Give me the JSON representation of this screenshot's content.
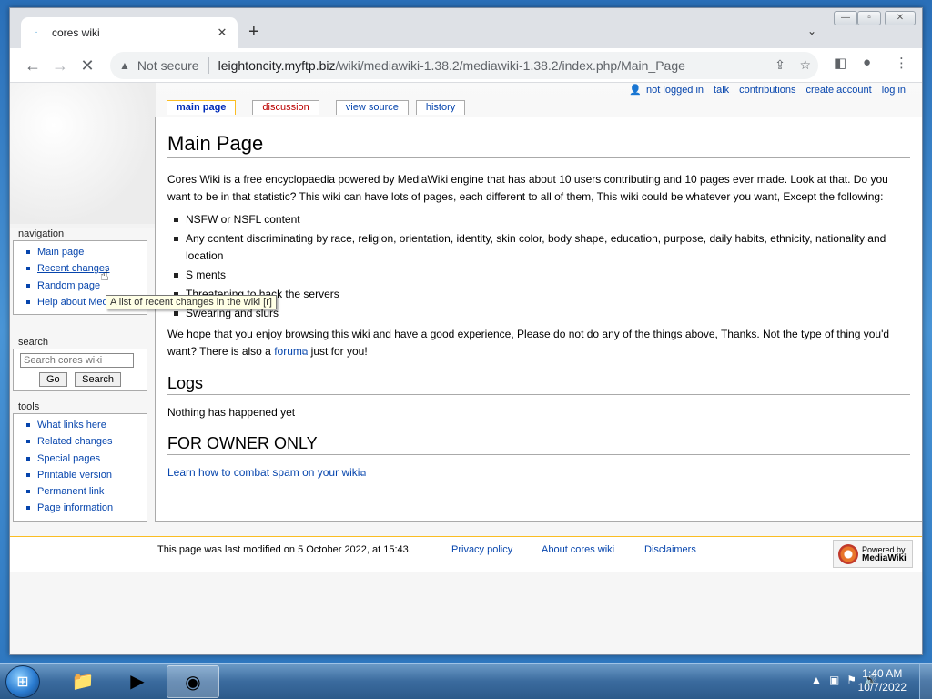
{
  "browser": {
    "tab_title": "cores wiki",
    "tab_favicon": "·",
    "tab_close": "✕",
    "new_tab": "+",
    "tab_search": "⌄",
    "security_label": "Not secure",
    "url_host": "leightoncity.myftp.biz",
    "url_path": "/wiki/mediawiki-1.38.2/mediawiki-1.38.2/index.php/Main_Page",
    "back_icon": "←",
    "forward_icon": "→",
    "reload_icon": "✕"
  },
  "personal": [
    "not logged in",
    "talk",
    "contributions",
    "create account",
    "log in"
  ],
  "content_tabs": {
    "main_page": "main page",
    "discussion": "discussion",
    "view_source": "view source",
    "history": "history"
  },
  "page": {
    "title": "Main Page",
    "intro": "Cores Wiki is a free encyclopaedia powered by MediaWiki engine that has about 10 users contributing and 10 pages ever made. Look at that. Do you want to be in that statistic? This wiki can have lots of pages, each different to all of them, This wiki could be whatever you want, Except the following:",
    "rules": [
      "NSFW or NSFL content",
      "Any content discriminating by race, religion, orientation, identity, skin color, body shape, education, purpose, daily habits, ethnicity, nationality and location",
      "S                 ments",
      "Threatening to hack the servers",
      "Swearing and slurs"
    ],
    "outro_before": "We hope that you enjoy browsing this wiki and have a good experience, Please do not do any of the things above, Thanks. Not the type of thing you'd want? There is also a ",
    "forum_link": "forum",
    "outro_after": " just for you!",
    "logs_heading": "Logs",
    "logs_text": "Nothing has happened yet",
    "owner_heading": "FOR OWNER ONLY",
    "owner_link": "Learn how to combat spam on your wiki"
  },
  "sidebar": {
    "navigation_heading": "navigation",
    "navigation": [
      "Main page",
      "Recent changes",
      "Random page",
      "Help about MediaWiki"
    ],
    "search_heading": "search",
    "search_placeholder": "Search cores wiki",
    "go_button": "Go",
    "search_button": "Search",
    "tools_heading": "tools",
    "tools": [
      "What links here",
      "Related changes",
      "Special pages",
      "Printable version",
      "Permanent link",
      "Page information"
    ]
  },
  "tooltip": "A list of recent changes in the wiki [r]",
  "footer": {
    "last_modified": "This page was last modified on 5 October 2022, at 15:43.",
    "privacy": "Privacy policy",
    "about": "About cores wiki",
    "disclaimers": "Disclaimers",
    "powered_by": "Powered by",
    "mediawiki": "MediaWiki"
  },
  "taskbar": {
    "time": "1:40 AM",
    "date": "10/7/2022"
  }
}
